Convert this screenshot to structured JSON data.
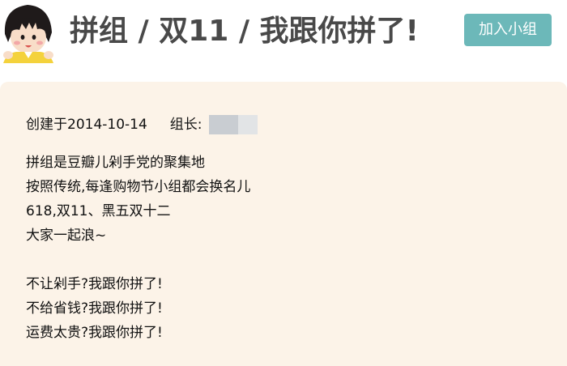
{
  "group": {
    "title": "拼组 / 双11 / 我跟你拼了!",
    "join_label": "加入小组"
  },
  "meta": {
    "created": "创建于2014-10-14",
    "leader_label": "组长:"
  },
  "intro": {
    "lines": [
      "拼组是豆瓣儿剁手党的聚集地",
      "按照传统,每逢购物节小组都会换名儿",
      "618,双11、黑五双十二",
      "大家一起浪~"
    ],
    "lines2": [
      "不让剁手?我跟你拼了!",
      "不给省钱?我跟你拼了!",
      "运费太贵?我跟你拼了!"
    ]
  }
}
